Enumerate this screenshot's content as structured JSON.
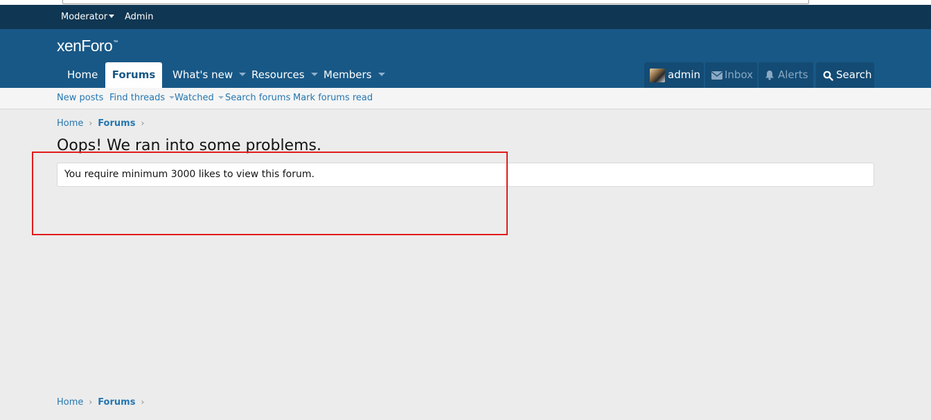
{
  "staff_bar": {
    "moderator_label": "Moderator",
    "admin_label": "Admin"
  },
  "header": {
    "logo_text": "xenForo",
    "logo_tm": "™"
  },
  "nav": {
    "tabs": [
      {
        "label": "Home"
      },
      {
        "label": "Forums"
      },
      {
        "label": "What's new"
      },
      {
        "label": "Resources"
      },
      {
        "label": "Members"
      }
    ],
    "active_tab": "Forums"
  },
  "user": {
    "username": "admin",
    "inbox_label": "Inbox",
    "alerts_label": "Alerts",
    "search_label": "Search"
  },
  "sub_nav": {
    "links": [
      {
        "label": "New posts"
      },
      {
        "label": "Find threads"
      },
      {
        "label": "Watched"
      },
      {
        "label": "Search forums"
      },
      {
        "label": "Mark forums read"
      }
    ]
  },
  "breadcrumb": {
    "home": "Home",
    "current": "Forums",
    "separator": "›"
  },
  "page": {
    "title": "Oops! We ran into some problems.",
    "error_message": "You require minimum 3000 likes to view this forum."
  },
  "colors": {
    "staff_bar": "#0f3652",
    "header": "#185886",
    "link": "#2577b1",
    "page_bg": "#ececec",
    "annotation": "#e21a1a"
  }
}
